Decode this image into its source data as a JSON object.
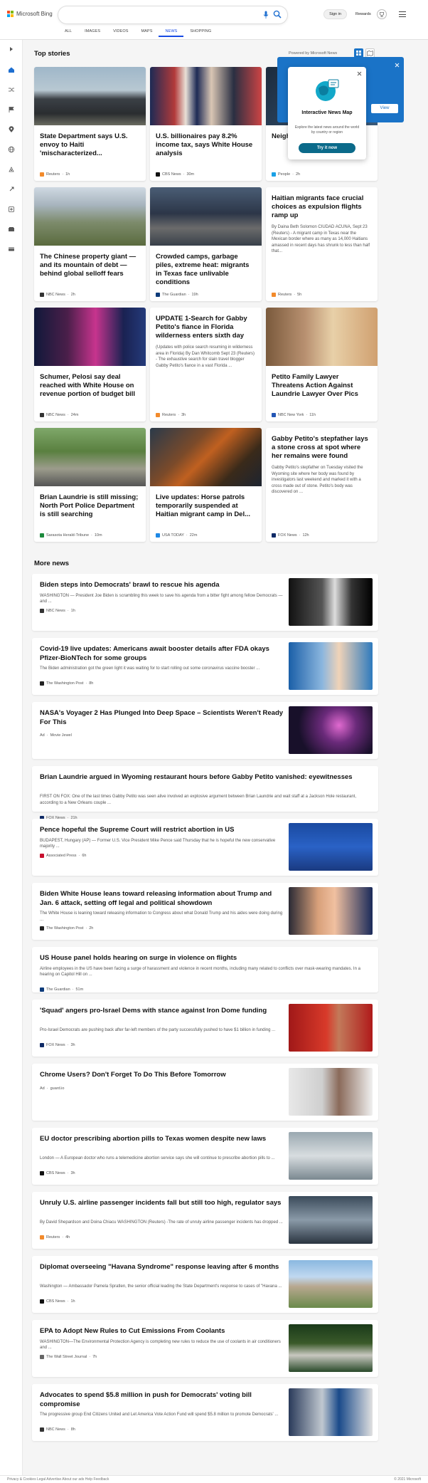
{
  "header": {
    "logo_text": "Microsoft Bing",
    "search_value": "",
    "nav": [
      "ALL",
      "IMAGES",
      "VIDEOS",
      "MAPS",
      "NEWS",
      "SHOPPING"
    ],
    "active_nav": "NEWS",
    "sign_in": "Sign in",
    "rewards": "Rewards"
  },
  "top_stories": {
    "title": "Top stories",
    "powered_by": "Powered by Microsoft News",
    "cards": [
      {
        "title": "State Department says U.S. envoy to Haiti 'mischaracterized...",
        "desc": "",
        "source": "Reuters",
        "age": "1h",
        "icon_color": "#f28a2b"
      },
      {
        "title": "U.S. billionaires pay 8.2% income tax, says White House analysis",
        "desc": "",
        "source": "CBS News",
        "age": "30m",
        "icon_color": "#111111"
      },
      {
        "title": "Neighb... Family... Camp...",
        "desc": "",
        "source": "People",
        "age": "2h",
        "icon_color": "#1aa1e6"
      },
      {
        "title": "The Chinese property giant — and its mountain of debt — behind global selloff fears",
        "desc": "",
        "source": "NBC News",
        "age": "2h",
        "icon_color": "#333333"
      },
      {
        "title": "Crowded camps, garbage piles, extreme heat: migrants in Texas face unlivable conditions",
        "desc": "",
        "source": "The Guardian",
        "age": "19h",
        "icon_color": "#0d3b7a"
      },
      {
        "title": "Haitian migrants face crucial choices as expulsion flights ramp up",
        "desc": "By Daina Beth Solomon CIUDAD ACUNA, Sept 23 (Reuters) - A migrant camp in Texas near the Mexican border where as many as 14,000 Haitians amassed in recent days has shrunk to less than half that...",
        "source": "Reuters",
        "age": "5h",
        "icon_color": "#f28a2b"
      },
      {
        "title": "Schumer, Pelosi say deal reached with White House on revenue portion of budget bill",
        "desc": "",
        "source": "NBC News",
        "age": "24m",
        "icon_color": "#333333"
      },
      {
        "title": "UPDATE 1-Search for Gabby Petito's fiance in Florida wilderness enters sixth day",
        "desc": "(Updates with police search resuming in wilderness area in Florida) By Dan Whitcomb Sept 23 (Reuters) - The exhaustive search for slain travel blogger Gabby Petito's fiance in a vast Florida ...",
        "source": "Reuters",
        "age": "3h",
        "icon_color": "#f28a2b"
      },
      {
        "title": "Petito Family Lawyer Threatens Action Against Laundrie Lawyer Over Pics",
        "desc": "",
        "source": "NBC New York",
        "age": "11h",
        "icon_color": "#2356b5"
      },
      {
        "title": "Brian Laundrie is still missing; North Port Police Department is still searching",
        "desc": "",
        "source": "Sarasota Herald-Tribune",
        "age": "10m",
        "icon_color": "#1c8a3c"
      },
      {
        "title": "Live updates: Horse patrols temporarily suspended at Haitian migrant camp in Del...",
        "desc": "",
        "source": "USA TODAY",
        "age": "22m",
        "icon_color": "#1e88e5"
      },
      {
        "title": "Gabby Petito's stepfather lays a stone cross at spot where her remains were found",
        "desc": "Gabby Petito's stepfather on Tuesday visited the Wyoming site where her body was found by investigators last weekend and marked it with a cross made out of stone. Petito's body was discovered on ...",
        "source": "FOX News",
        "age": "12h",
        "icon_color": "#0f2a66"
      }
    ]
  },
  "popup": {
    "title": "Interactive News Map",
    "desc": "Explore the latest news around the world by country or region",
    "button": "Try it now",
    "bg_button": "View"
  },
  "more_news": {
    "title": "More news",
    "items": [
      {
        "title": "Biden steps into Democrats' brawl to rescue his agenda",
        "desc": "WASHINGTON — President Joe Biden is scrambling this week to save his agenda from a bitter fight among fellow Democrats — and ...",
        "source": "NBC News",
        "age": "1h",
        "icon_color": "#333333",
        "thumb": "bw"
      },
      {
        "title": "Covid-19 live updates: Americans await booster details after FDA okays Pfizer-BioNTech for some groups",
        "desc": "The Biden administration got the green light it was waiting for to start rolling out some coronavirus vaccine booster ...",
        "source": "The Washington Post",
        "age": "8h",
        "icon_color": "#222222",
        "thumb": "vaccine"
      },
      {
        "title": "NASA's Voyager 2 Has Plunged Into Deep Space – Scientists Weren't Ready For This",
        "desc": "",
        "source": "Movie Jewel",
        "age": "",
        "ad": "Ad",
        "icon_color": "",
        "thumb": "space"
      },
      {
        "title": "Brian Laundrie argued in Wyoming restaurant hours before Gabby Petito vanished: eyewitnesses",
        "desc": "FIRST ON FOX: One of the last times Gabby Petito was seen alive involved an explosive argument between Brian Laundrie and wait staff at a Jackson Hole restaurant, according to a New Orleans couple ...",
        "source": "FOX News",
        "age": "21h",
        "icon_color": "#0f2a66",
        "thumb": ""
      },
      {
        "title": "Pence hopeful the Supreme Court will restrict abortion in US",
        "desc": "BUDAPEST, Hungary (AP) — Former U.S. Vice President Mike Pence said Thursday that he is hopeful the new conservative majority ...",
        "source": "Associated Press",
        "age": "6h",
        "icon_color": "#c8102e",
        "thumb": "stage"
      },
      {
        "title": "Biden White House leans toward releasing information about Trump and Jan. 6 attack, setting off legal and political showdown",
        "desc": "The White House is leaning toward releasing information to Congress about what Donald Trump and his aides were doing during ...",
        "source": "The Washington Post",
        "age": "2h",
        "icon_color": "#222222",
        "thumb": "trump"
      },
      {
        "title": "US House panel holds hearing on surge in violence on flights",
        "desc": "Airline employees in the US have been facing a surge of harassment and violence in recent months, including many related to conflicts over mask-wearing mandates. In a hearing on Capitol Hill on ...",
        "source": "The Guardian",
        "age": "51m",
        "icon_color": "#0d3b7a",
        "thumb": ""
      },
      {
        "title": "'Squad' angers pro-Israel Dems with stance against Iron Dome funding",
        "desc": "Pro-Israel Democrats are pushing back after far-left members of the party successfully pushed to have $1 billion in funding ...",
        "source": "FOX News",
        "age": "3h",
        "icon_color": "#0f2a66",
        "thumb": "red"
      },
      {
        "title": "Chrome Users? Don't Forget To Do This Before Tomorrow",
        "desc": "",
        "source": "guard.io",
        "age": "",
        "ad": "Ad",
        "icon_color": "",
        "thumb": "laptop"
      },
      {
        "title": "EU doctor prescribing abortion pills to Texas women despite new laws",
        "desc": "London — A European doctor who runs a telemedicine abortion service says she will continue to prescribe abortion pills to ...",
        "source": "CBS News",
        "age": "3h",
        "icon_color": "#111111",
        "thumb": "clinic"
      },
      {
        "title": "Unruly U.S. airline passenger incidents fall but still too high, regulator says",
        "desc": "By David Shepardson and Doina Chiacu WASHINGTON (Reuters) -The rate of unruly airline passenger incidents has dropped ...",
        "source": "Reuters",
        "age": "4h",
        "icon_color": "#f28a2b",
        "thumb": "airport"
      },
      {
        "title": "Diplomat overseeing \"Havana Syndrome\" response leaving after 6 months",
        "desc": "Washington — Ambassador Pamela Spratlen, the senior official leading the State Department's response to cases of \"Havana ...",
        "source": "CBS News",
        "age": "1h",
        "icon_color": "#111111",
        "thumb": "building"
      },
      {
        "title": "EPA to Adopt New Rules to Cut Emissions From Coolants",
        "desc": "WASHINGTON—The Environmental Protection Agency is completing new rules to reduce the use of coolants in air conditioners and ...",
        "source": "The Wall Street Journal",
        "age": "7h",
        "icon_color": "#666666",
        "thumb": "trees"
      },
      {
        "title": "Advocates to spend $5.8 million in push for Democrats' voting bill compromise",
        "desc": "The progressive group End Citizens United and Let America Vote Action Fund will spend $5.8 million to promote Democrats' ...",
        "source": "NBC News",
        "age": "8h",
        "icon_color": "#333333",
        "thumb": "voting"
      }
    ]
  },
  "footer": {
    "left": "Privacy & Cookies   Legal   Advertise   About our ads   Help   Feedback",
    "right": "© 2021 Microsoft"
  }
}
